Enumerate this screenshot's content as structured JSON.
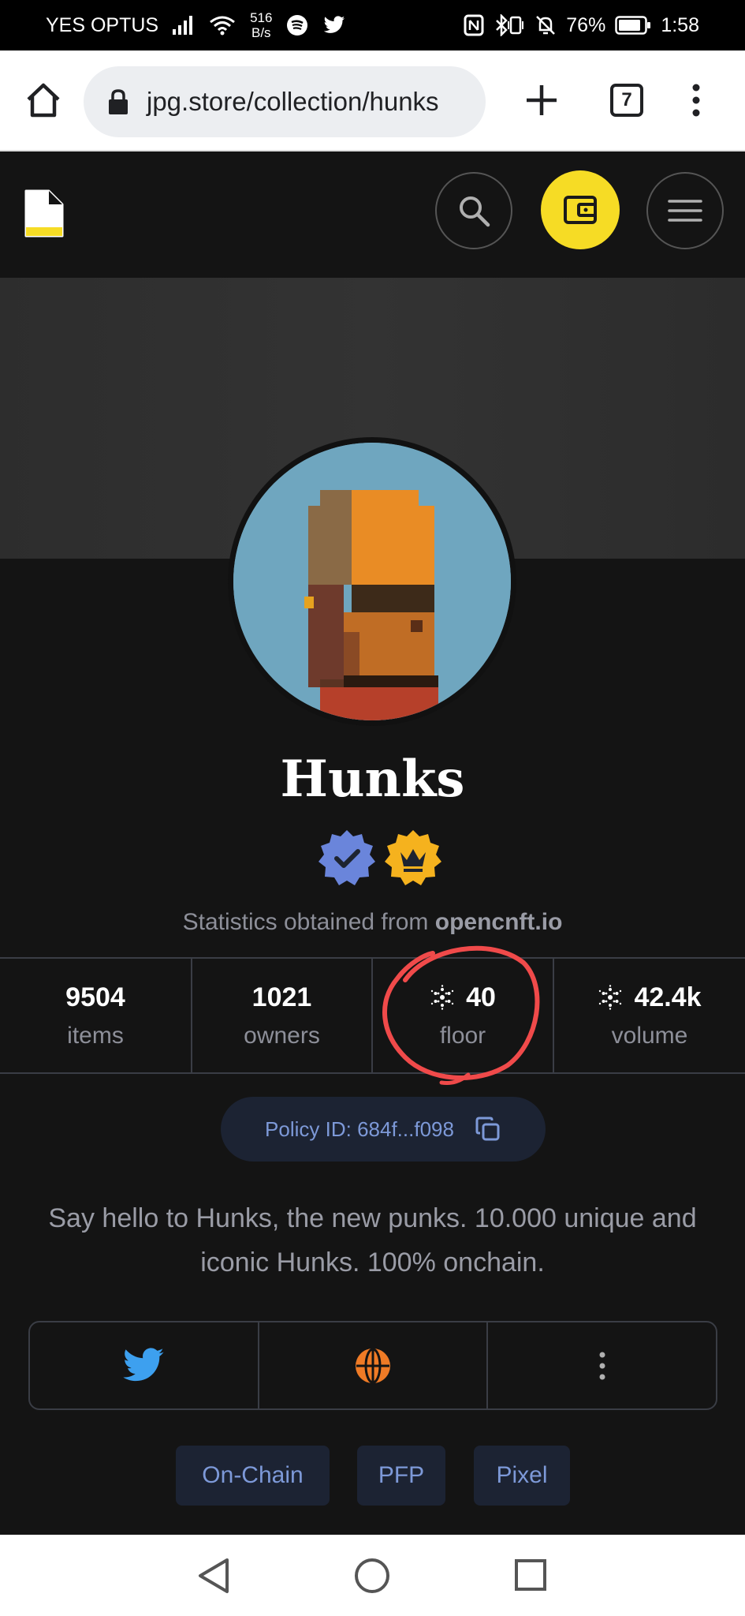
{
  "statusbar": {
    "carrier": "YES OPTUS",
    "speed_value": "516",
    "speed_unit": "B/s",
    "battery": "76%",
    "time": "1:58"
  },
  "browser": {
    "url": "jpg.store/collection/hunks",
    "tab_count": "7"
  },
  "collection": {
    "name": "Hunks",
    "stats_source_prefix": "Statistics obtained from ",
    "stats_source_site": "opencnft.io",
    "stats": [
      {
        "value": "9504",
        "label": "items"
      },
      {
        "value": "1021",
        "label": "owners"
      },
      {
        "value": "40",
        "label": "floor"
      },
      {
        "value": "42.4k",
        "label": "volume"
      }
    ],
    "policy_id": "Policy ID: 684f...f098",
    "description": "Say hello to Hunks, the new punks. 10.000 unique and iconic Hunks. 100% onchain.",
    "tags": [
      "On-Chain",
      "PFP",
      "Pixel"
    ]
  },
  "colors": {
    "accent_yellow": "#f6dc25",
    "verified_blue": "#6a85db",
    "crown_gold": "#f5b21e",
    "annotation_red": "#f04a4a"
  },
  "icons": {
    "socials": [
      "twitter-icon",
      "globe-icon",
      "more-vertical-icon"
    ]
  }
}
